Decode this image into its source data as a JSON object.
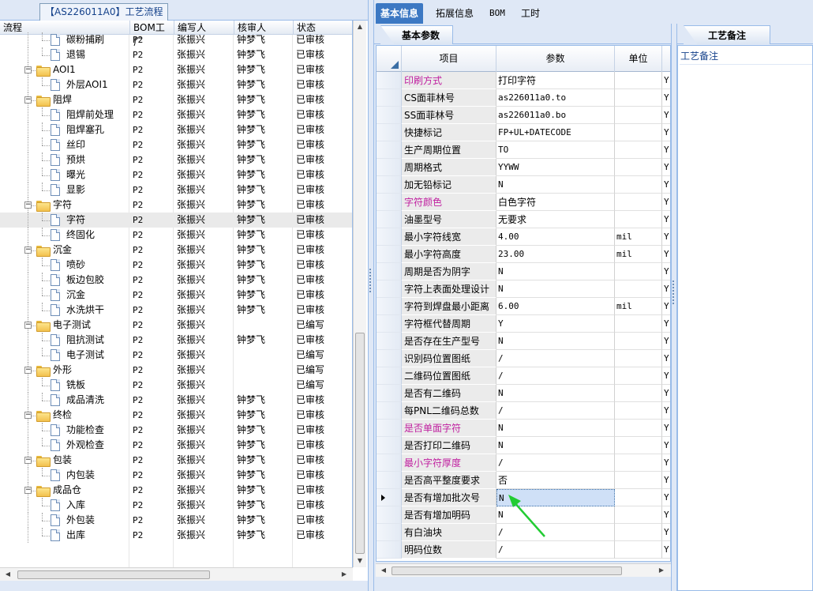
{
  "left_panel": {
    "title": "【AS226011A0】工艺流程",
    "columns": [
      "流程",
      "BOM工厂",
      "编写人",
      "核审人",
      "状态"
    ],
    "rows": [
      {
        "name": "碳粉捕刷",
        "level": 2,
        "type": "doc",
        "bom": "P2",
        "writer": "张振兴",
        "auditor": "钟梦飞",
        "status": "已审核",
        "partial": true
      },
      {
        "name": "退锡",
        "level": 2,
        "type": "doc",
        "bom": "P2",
        "writer": "张振兴",
        "auditor": "钟梦飞",
        "status": "已审核"
      },
      {
        "name": "AOI1",
        "level": 1,
        "type": "folder",
        "bom": "P2",
        "writer": "张振兴",
        "auditor": "钟梦飞",
        "status": "已审核"
      },
      {
        "name": "外层AOI1",
        "level": 2,
        "type": "doc",
        "bom": "P2",
        "writer": "张振兴",
        "auditor": "钟梦飞",
        "status": "已审核"
      },
      {
        "name": "阻焊",
        "level": 1,
        "type": "folder",
        "bom": "P2",
        "writer": "张振兴",
        "auditor": "钟梦飞",
        "status": "已审核"
      },
      {
        "name": "阻焊前处理",
        "level": 2,
        "type": "doc",
        "bom": "P2",
        "writer": "张振兴",
        "auditor": "钟梦飞",
        "status": "已审核"
      },
      {
        "name": "阻焊塞孔",
        "level": 2,
        "type": "doc",
        "bom": "P2",
        "writer": "张振兴",
        "auditor": "钟梦飞",
        "status": "已审核"
      },
      {
        "name": "丝印",
        "level": 2,
        "type": "doc",
        "bom": "P2",
        "writer": "张振兴",
        "auditor": "钟梦飞",
        "status": "已审核"
      },
      {
        "name": "预烘",
        "level": 2,
        "type": "doc",
        "bom": "P2",
        "writer": "张振兴",
        "auditor": "钟梦飞",
        "status": "已审核"
      },
      {
        "name": "曝光",
        "level": 2,
        "type": "doc",
        "bom": "P2",
        "writer": "张振兴",
        "auditor": "钟梦飞",
        "status": "已审核"
      },
      {
        "name": "显影",
        "level": 2,
        "type": "doc",
        "bom": "P2",
        "writer": "张振兴",
        "auditor": "钟梦飞",
        "status": "已审核"
      },
      {
        "name": "字符",
        "level": 1,
        "type": "folder",
        "bom": "P2",
        "writer": "张振兴",
        "auditor": "钟梦飞",
        "status": "已审核"
      },
      {
        "name": "字符",
        "level": 2,
        "type": "doc",
        "bom": "P2",
        "writer": "张振兴",
        "auditor": "钟梦飞",
        "status": "已审核",
        "selected": true
      },
      {
        "name": "终固化",
        "level": 2,
        "type": "doc",
        "bom": "P2",
        "writer": "张振兴",
        "auditor": "钟梦飞",
        "status": "已审核"
      },
      {
        "name": "沉金",
        "level": 1,
        "type": "folder",
        "bom": "P2",
        "writer": "张振兴",
        "auditor": "钟梦飞",
        "status": "已审核"
      },
      {
        "name": "喷砂",
        "level": 2,
        "type": "doc",
        "bom": "P2",
        "writer": "张振兴",
        "auditor": "钟梦飞",
        "status": "已审核"
      },
      {
        "name": "板边包胶",
        "level": 2,
        "type": "doc",
        "bom": "P2",
        "writer": "张振兴",
        "auditor": "钟梦飞",
        "status": "已审核"
      },
      {
        "name": "沉金",
        "level": 2,
        "type": "doc",
        "bom": "P2",
        "writer": "张振兴",
        "auditor": "钟梦飞",
        "status": "已审核"
      },
      {
        "name": "水洗烘干",
        "level": 2,
        "type": "doc",
        "bom": "P2",
        "writer": "张振兴",
        "auditor": "钟梦飞",
        "status": "已审核"
      },
      {
        "name": "电子测试",
        "level": 1,
        "type": "folder",
        "bom": "P2",
        "writer": "张振兴",
        "auditor": "",
        "status": "已编写"
      },
      {
        "name": "阻抗测试",
        "level": 2,
        "type": "doc",
        "bom": "P2",
        "writer": "张振兴",
        "auditor": "钟梦飞",
        "status": "已审核"
      },
      {
        "name": "电子测试",
        "level": 2,
        "type": "doc",
        "bom": "P2",
        "writer": "张振兴",
        "auditor": "",
        "status": "已编写"
      },
      {
        "name": "外形",
        "level": 1,
        "type": "folder",
        "bom": "P2",
        "writer": "张振兴",
        "auditor": "",
        "status": "已编写"
      },
      {
        "name": "铣板",
        "level": 2,
        "type": "doc",
        "bom": "P2",
        "writer": "张振兴",
        "auditor": "",
        "status": "已编写"
      },
      {
        "name": "成品清洗",
        "level": 2,
        "type": "doc",
        "bom": "P2",
        "writer": "张振兴",
        "auditor": "钟梦飞",
        "status": "已审核"
      },
      {
        "name": "终检",
        "level": 1,
        "type": "folder",
        "bom": "P2",
        "writer": "张振兴",
        "auditor": "钟梦飞",
        "status": "已审核"
      },
      {
        "name": "功能检查",
        "level": 2,
        "type": "doc",
        "bom": "P2",
        "writer": "张振兴",
        "auditor": "钟梦飞",
        "status": "已审核"
      },
      {
        "name": "外观检查",
        "level": 2,
        "type": "doc",
        "bom": "P2",
        "writer": "张振兴",
        "auditor": "钟梦飞",
        "status": "已审核"
      },
      {
        "name": "包装",
        "level": 1,
        "type": "folder",
        "bom": "P2",
        "writer": "张振兴",
        "auditor": "钟梦飞",
        "status": "已审核"
      },
      {
        "name": "内包装",
        "level": 2,
        "type": "doc",
        "bom": "P2",
        "writer": "张振兴",
        "auditor": "钟梦飞",
        "status": "已审核"
      },
      {
        "name": "成品仓",
        "level": 1,
        "type": "folder",
        "bom": "P2",
        "writer": "张振兴",
        "auditor": "钟梦飞",
        "status": "已审核"
      },
      {
        "name": "入库",
        "level": 2,
        "type": "doc",
        "bom": "P2",
        "writer": "张振兴",
        "auditor": "钟梦飞",
        "status": "已审核"
      },
      {
        "name": "外包装",
        "level": 2,
        "type": "doc",
        "bom": "P2",
        "writer": "张振兴",
        "auditor": "钟梦飞",
        "status": "已审核"
      },
      {
        "name": "出库",
        "level": 2,
        "type": "doc",
        "bom": "P2",
        "writer": "张振兴",
        "auditor": "钟梦飞",
        "status": "已审核"
      }
    ]
  },
  "top_tabs": [
    "基本信息",
    "拓展信息",
    "BOM",
    "工时"
  ],
  "param_panel": {
    "tab": "基本参数",
    "columns": [
      "项目",
      "参数",
      "单位"
    ],
    "rows": [
      {
        "key": "印刷方式",
        "value": "打印字符",
        "unit": "",
        "flag": "Y",
        "highlight": true,
        "cn": true
      },
      {
        "key": "CS面菲林号",
        "value": "as226011a0.to",
        "unit": "",
        "flag": "Y"
      },
      {
        "key": "SS面菲林号",
        "value": "as226011a0.bo",
        "unit": "",
        "flag": "Y"
      },
      {
        "key": "快捷标记",
        "value": "FP+UL+DATECODE",
        "unit": "",
        "flag": "Y"
      },
      {
        "key": "生产周期位置",
        "value": "TO",
        "unit": "",
        "flag": "Y"
      },
      {
        "key": "周期格式",
        "value": "YYWW",
        "unit": "",
        "flag": "Y"
      },
      {
        "key": "加无铅标记",
        "value": "N",
        "unit": "",
        "flag": "Y"
      },
      {
        "key": "字符颜色",
        "value": "白色字符",
        "unit": "",
        "flag": "Y",
        "highlight": true,
        "cn": true
      },
      {
        "key": "油墨型号",
        "value": "无要求",
        "unit": "",
        "flag": "Y",
        "cn": true
      },
      {
        "key": "最小字符线宽",
        "value": "4.00",
        "unit": "mil",
        "flag": "Y"
      },
      {
        "key": "最小字符高度",
        "value": "23.00",
        "unit": "mil",
        "flag": "Y"
      },
      {
        "key": "周期是否为阴字",
        "value": "N",
        "unit": "",
        "flag": "Y"
      },
      {
        "key": "字符上表面处理设计",
        "value": "N",
        "unit": "",
        "flag": "Y"
      },
      {
        "key": "字符到焊盘最小距离",
        "value": "6.00",
        "unit": "mil",
        "flag": "Y"
      },
      {
        "key": "字符框代替周期",
        "value": "Y",
        "unit": "",
        "flag": "Y"
      },
      {
        "key": "是否存在生产型号",
        "value": "N",
        "unit": "",
        "flag": "Y"
      },
      {
        "key": "识别码位置图纸",
        "value": "/",
        "unit": "",
        "flag": "Y"
      },
      {
        "key": "二维码位置图纸",
        "value": "/",
        "unit": "",
        "flag": "Y"
      },
      {
        "key": "是否有二维码",
        "value": "N",
        "unit": "",
        "flag": "Y"
      },
      {
        "key": "每PNL二维码总数",
        "value": "/",
        "unit": "",
        "flag": "Y"
      },
      {
        "key": "是否单面字符",
        "value": "N",
        "unit": "",
        "flag": "Y",
        "highlight": true
      },
      {
        "key": "是否打印二维码",
        "value": "N",
        "unit": "",
        "flag": "Y"
      },
      {
        "key": "最小字符厚度",
        "value": "/",
        "unit": "",
        "flag": "Y",
        "highlight": true
      },
      {
        "key": "是否高平整度要求",
        "value": "否",
        "unit": "",
        "flag": "Y",
        "cn": true
      },
      {
        "key": "是否有增加批次号",
        "value": "N",
        "unit": "",
        "flag": "Y",
        "selected": true
      },
      {
        "key": "是否有增加明码",
        "value": "N",
        "unit": "",
        "flag": "Y"
      },
      {
        "key": "有白油块",
        "value": "/",
        "unit": "",
        "flag": "Y"
      },
      {
        "key": "明码位数",
        "value": "/",
        "unit": "",
        "flag": "Y"
      }
    ]
  },
  "notes_panel": {
    "tab": "工艺备注",
    "label": "工艺备注"
  },
  "colors": {
    "highlight_text": "#c020a0",
    "tab_active": "#3c78c3",
    "arrow": "#22cc33"
  }
}
